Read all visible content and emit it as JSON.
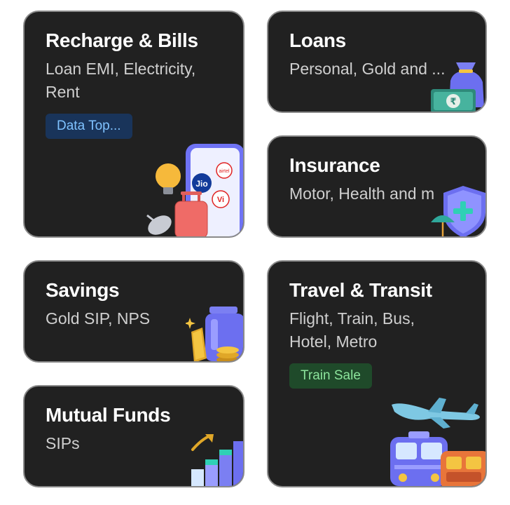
{
  "cards": {
    "recharge": {
      "title": "Recharge & Bills",
      "subtitle_line1": "Loan EMI, Electricity,",
      "subtitle_line2": "Rent",
      "chip": "Data Top...",
      "icon": "phone-recharge-illustration",
      "brand_labels": [
        "Jio",
        "airtel",
        "Vi"
      ]
    },
    "loans": {
      "title": "Loans",
      "subtitle": "Personal, Gold and ...",
      "icon": "money-bag-rupee-illustration",
      "rupee_symbol": "₹"
    },
    "insurance": {
      "title": "Insurance",
      "subtitle": "Motor, Health and m",
      "icon": "shield-umbrella-illustration"
    },
    "savings": {
      "title": "Savings",
      "subtitle": "Gold SIP, NPS",
      "icon": "gold-jar-coins-illustration"
    },
    "travel": {
      "title": "Travel & Transit",
      "subtitle_line1": "Flight, Train, Bus,",
      "subtitle_line2": "Hotel, Metro",
      "chip": "Train Sale",
      "icon": "plane-train-bus-illustration"
    },
    "mutual_funds": {
      "title": "Mutual Funds",
      "subtitle": "SIPs",
      "icon": "growth-bar-chart-illustration"
    }
  },
  "colors": {
    "card_bg": "#212121",
    "card_border": "#8a8a8a",
    "title": "#ffffff",
    "subtitle": "#cfcfcf",
    "chip_blue_bg": "#19345a",
    "chip_blue_text": "#7fc2ff",
    "chip_green_bg": "#1f4a2a",
    "chip_green_text": "#8ce49c",
    "accent_purple": "#6c6ff0"
  }
}
